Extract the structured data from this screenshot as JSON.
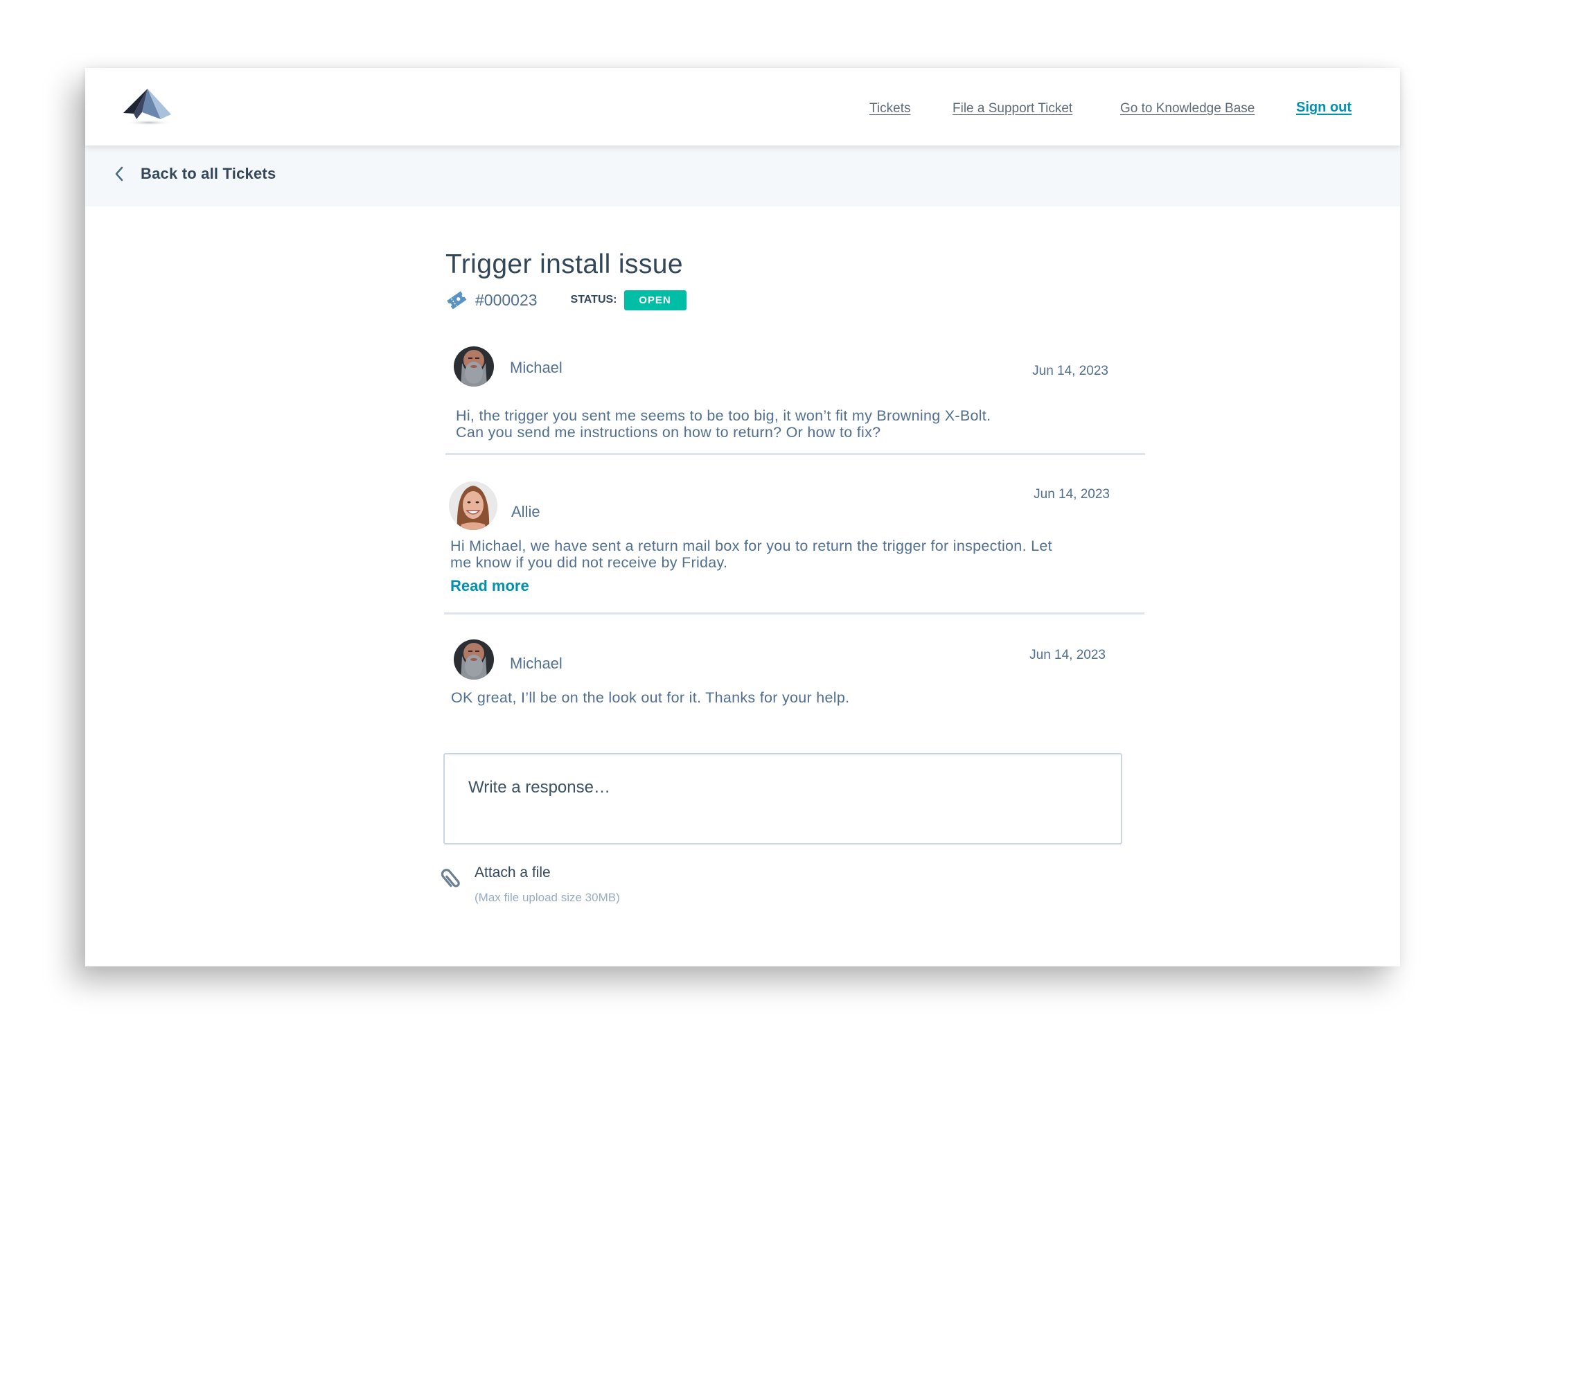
{
  "header": {
    "logo": "mountain-logo",
    "nav": [
      {
        "label": "Tickets"
      },
      {
        "label": "File a Support Ticket"
      },
      {
        "label": "Go to Knowledge Base"
      },
      {
        "label": "Sign out"
      }
    ]
  },
  "back_link": {
    "icon": "chevron-left-icon",
    "label": "Back to all Tickets"
  },
  "ticket": {
    "title": "Trigger install issue",
    "icon": "ticket-icon",
    "number": "#000023",
    "status_label": "STATUS:",
    "status": "OPEN",
    "status_color": "#00bda5"
  },
  "messages": [
    {
      "author": "Michael",
      "date": "Jun 14, 2023",
      "lines": [
        "Hi, the trigger you sent me seems to be too big, it won’t fit my Browning X-Bolt.",
        "Can you send me instructions on how to return? Or how to fix?"
      ]
    },
    {
      "author": "Allie",
      "date": "Jun 14, 2023",
      "lines": [
        "Hi Michael, we have sent a return mail box for you to return the trigger for inspection.  Let",
        "me know if you did not receive by Friday."
      ],
      "read_more": "Read more"
    },
    {
      "author": "Michael",
      "date": "Jun 14, 2023",
      "lines": [
        "OK great, I’ll be on the look out for it. Thanks for your help."
      ]
    }
  ],
  "reply": {
    "placeholder": "Write a response…",
    "value": ""
  },
  "attachment": {
    "icon": "paperclip-icon",
    "label": "Attach a file",
    "hint": "(Max file upload size 30MB)"
  },
  "colors": {
    "link": "#0091ae",
    "text": "#33475b",
    "muted": "#516f90",
    "status_open": "#00bda5"
  }
}
